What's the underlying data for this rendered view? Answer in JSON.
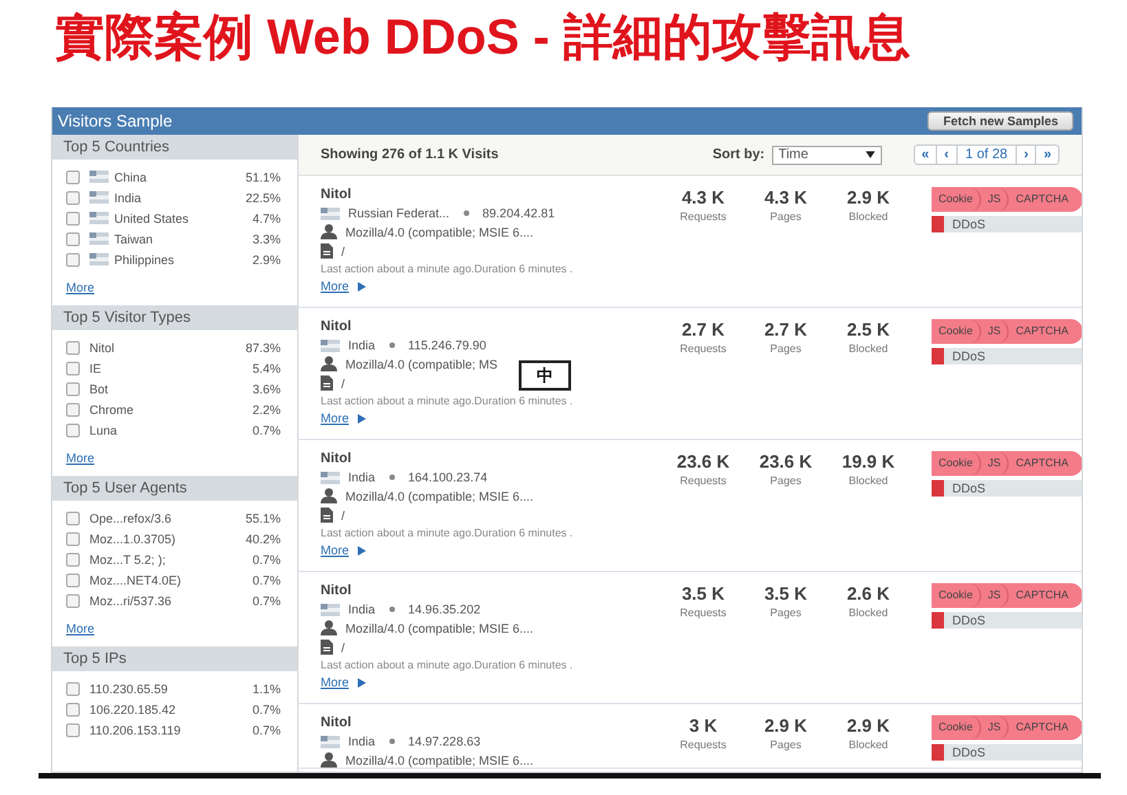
{
  "slide_title": "實際案例 Web DDoS - 詳細的攻擊訊息",
  "panel": {
    "title": "Visitors Sample",
    "fetch_button": "Fetch new Samples"
  },
  "sidebar": {
    "sections": [
      {
        "title": "Top 5 Countries",
        "kind": "flag",
        "more": "More",
        "items": [
          {
            "label": "China",
            "value": "51.1%",
            "checked": false
          },
          {
            "label": "India",
            "value": "22.5%",
            "checked": false
          },
          {
            "label": "United States",
            "value": "4.7%",
            "checked": false
          },
          {
            "label": "Taiwan",
            "value": "3.3%",
            "checked": false
          },
          {
            "label": "Philippines",
            "value": "2.9%",
            "checked": false
          }
        ]
      },
      {
        "title": "Top 5 Visitor Types",
        "kind": "plain",
        "more": "More",
        "items": [
          {
            "label": "Nitol",
            "value": "87.3%",
            "checked": false
          },
          {
            "label": "IE",
            "value": "5.4%",
            "checked": false
          },
          {
            "label": "Bot",
            "value": "3.6%",
            "checked": false
          },
          {
            "label": "Chrome",
            "value": "2.2%",
            "checked": false
          },
          {
            "label": "Luna",
            "value": "0.7%",
            "checked": false
          }
        ]
      },
      {
        "title": "Top 5 User Agents",
        "kind": "plain",
        "more": "More",
        "items": [
          {
            "label": "Ope...refox/3.6",
            "value": "55.1%",
            "checked": false
          },
          {
            "label": "Moz...1.0.3705)",
            "value": "40.2%",
            "checked": false
          },
          {
            "label": "Moz...T 5.2; );",
            "value": "0.7%",
            "checked": false
          },
          {
            "label": "Moz....NET4.0E)",
            "value": "0.7%",
            "checked": false
          },
          {
            "label": "Moz...ri/537.36",
            "value": "0.7%",
            "checked": false
          }
        ]
      },
      {
        "title": "Top 5 IPs",
        "kind": "plain",
        "items": [
          {
            "label": "110.230.65.59",
            "value": "1.1%",
            "checked": false
          },
          {
            "label": "106.220.185.42",
            "value": "0.7%",
            "checked": false
          },
          {
            "label": "110.206.153.119",
            "value": "0.7%",
            "checked": false
          }
        ]
      }
    ]
  },
  "toolbar": {
    "summary": "Showing 276 of 1.1 K Visits",
    "sort_label": "Sort by:",
    "sort_value": "Time",
    "pager": {
      "first": "«",
      "prev": "‹",
      "page": "1 of 28",
      "next": "›",
      "last": "»"
    }
  },
  "visits": [
    {
      "name": "Nitol",
      "country": "Russian Federat...",
      "ip": "89.204.42.81",
      "agent": "Mozilla/4.0 (compatible; MSIE 6....",
      "page": "/",
      "last_action": "Last action about a minute ago.Duration 6 minutes .",
      "more": "More",
      "stats": [
        {
          "value": "4.3 K",
          "label": "Requests"
        },
        {
          "value": "4.3 K",
          "label": "Pages"
        },
        {
          "value": "2.9 K",
          "label": "Blocked"
        }
      ],
      "challenges": [
        "Cookie",
        "JS",
        "CAPTCHA"
      ],
      "tags": [
        {
          "label": "DDoS",
          "color": "#d9363e"
        }
      ]
    },
    {
      "name": "Nitol",
      "country": "India",
      "ip": "115.246.79.90",
      "agent": "Mozilla/4.0 (compatible; MS",
      "page": "/",
      "last_action": "Last action about a minute ago.Duration 6 minutes .",
      "more": "More",
      "stats": [
        {
          "value": "2.7 K",
          "label": "Requests"
        },
        {
          "value": "2.7 K",
          "label": "Pages"
        },
        {
          "value": "2.5 K",
          "label": "Blocked"
        }
      ],
      "challenges": [
        "Cookie",
        "JS",
        "CAPTCHA"
      ],
      "tags": [
        {
          "label": "DDoS",
          "color": "#d9363e"
        }
      ]
    },
    {
      "name": "Nitol",
      "country": "India",
      "ip": "164.100.23.74",
      "agent": "Mozilla/4.0 (compatible; MSIE 6....",
      "page": "/",
      "last_action": "Last action about a minute ago.Duration 6 minutes .",
      "more": "More",
      "stats": [
        {
          "value": "23.6 K",
          "label": "Requests"
        },
        {
          "value": "23.6 K",
          "label": "Pages"
        },
        {
          "value": "19.9 K",
          "label": "Blocked"
        }
      ],
      "challenges": [
        "Cookie",
        "JS",
        "CAPTCHA"
      ],
      "tags": [
        {
          "label": "DDoS",
          "color": "#d9363e"
        }
      ]
    },
    {
      "name": "Nitol",
      "country": "India",
      "ip": "14.96.35.202",
      "agent": "Mozilla/4.0 (compatible; MSIE 6....",
      "page": "/",
      "last_action": "Last action about a minute ago.Duration 6 minutes .",
      "more": "More",
      "stats": [
        {
          "value": "3.5 K",
          "label": "Requests"
        },
        {
          "value": "3.5 K",
          "label": "Pages"
        },
        {
          "value": "2.6 K",
          "label": "Blocked"
        }
      ],
      "challenges": [
        "Cookie",
        "JS",
        "CAPTCHA"
      ],
      "tags": [
        {
          "label": "DDoS",
          "color": "#d9363e"
        }
      ]
    },
    {
      "name": "Nitol",
      "country": "India",
      "ip": "14.97.228.63",
      "agent": "Mozilla/4.0 (compatible; MSIE 6....",
      "stats": [
        {
          "value": "3 K",
          "label": "Requests"
        },
        {
          "value": "2.9 K",
          "label": "Pages"
        },
        {
          "value": "2.9 K",
          "label": "Blocked"
        }
      ],
      "challenges": [
        "Cookie",
        "JS",
        "CAPTCHA"
      ],
      "tags": [
        {
          "label": "DDoS",
          "color": "#d9363e"
        }
      ]
    }
  ],
  "ime_indicator": "中"
}
